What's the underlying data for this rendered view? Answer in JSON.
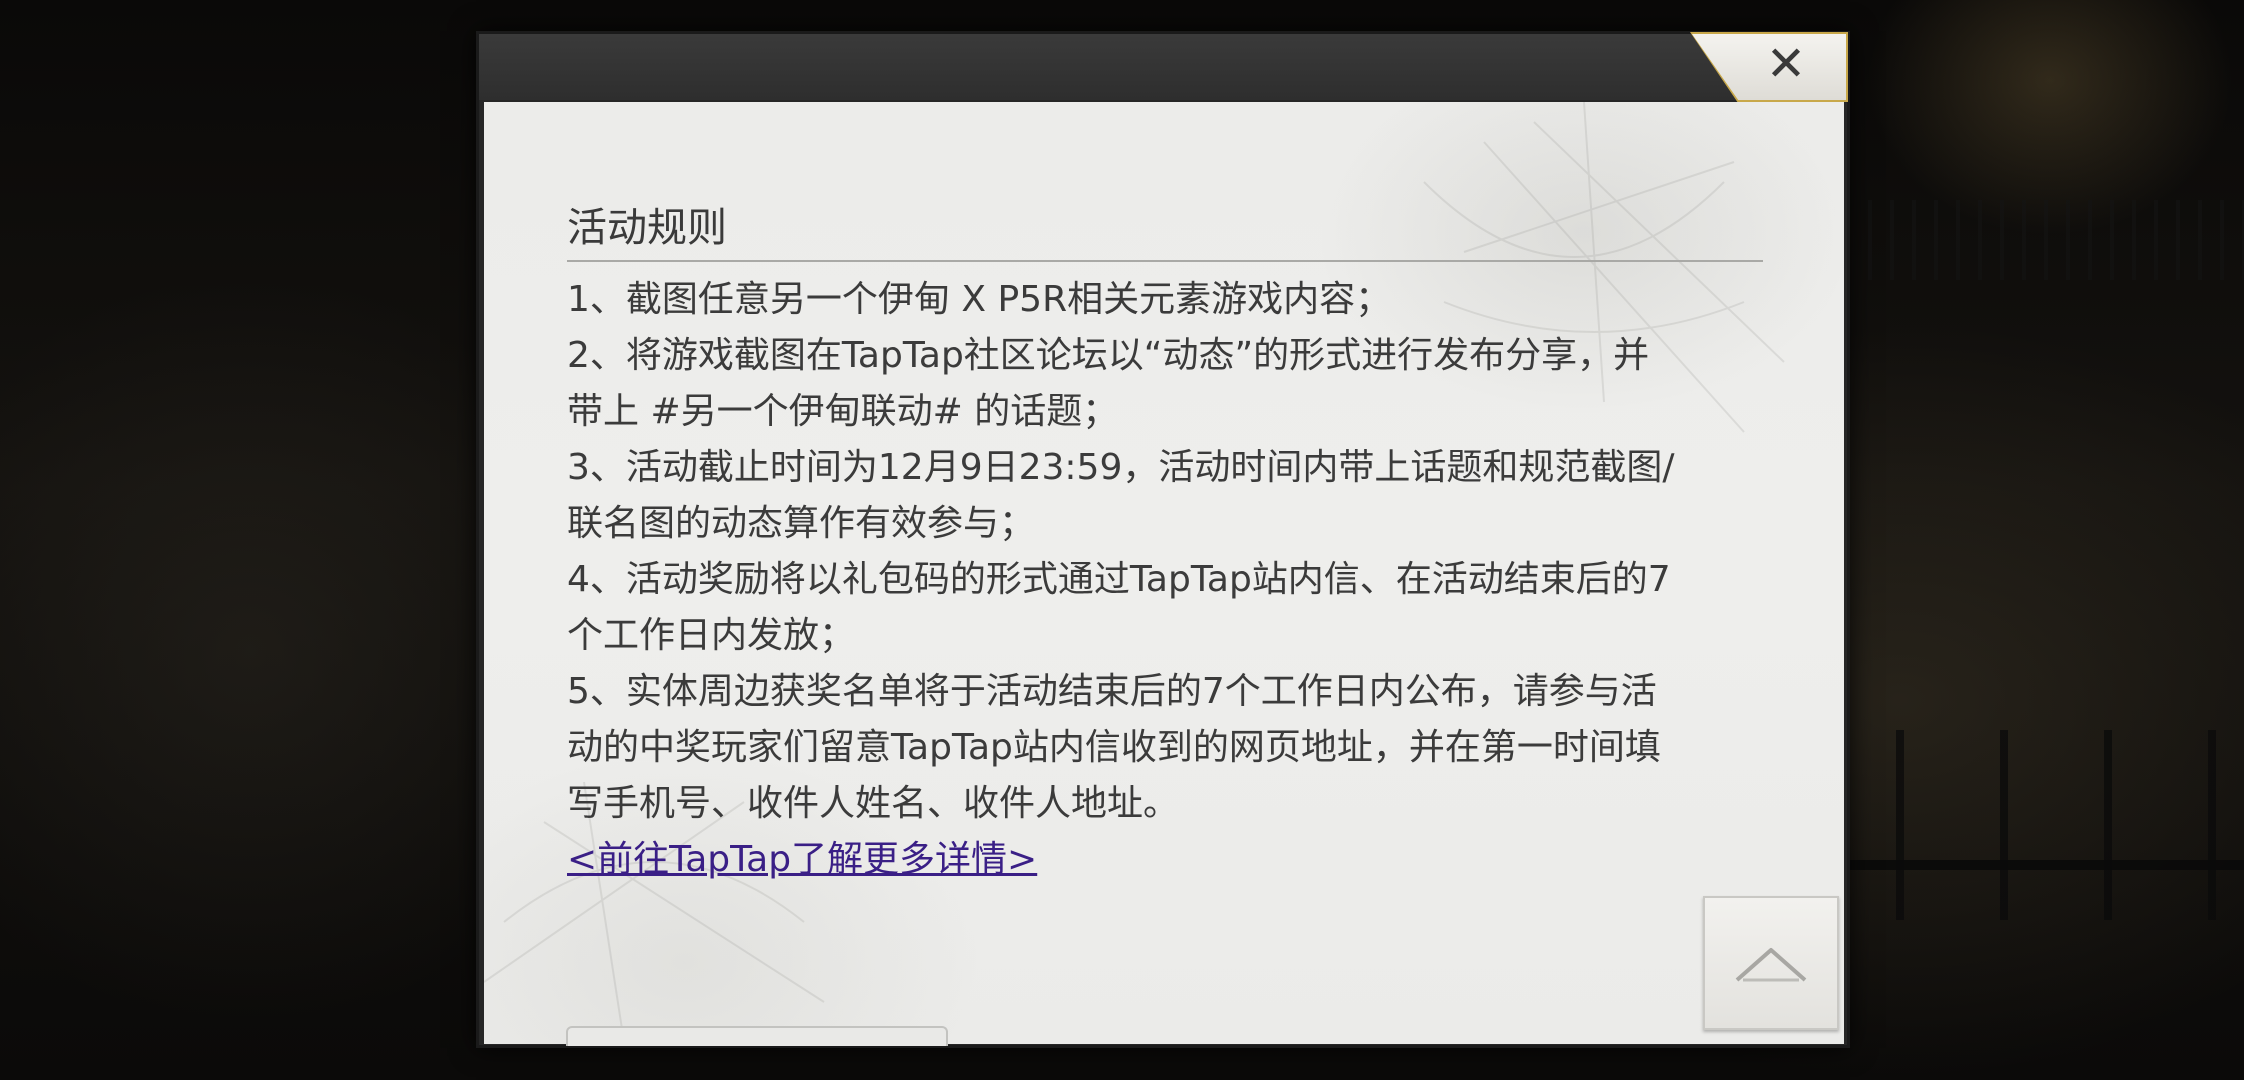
{
  "dialog": {
    "close_icon": "close-icon",
    "scroll_top_icon": "chevron-up-icon"
  },
  "rules": {
    "title": "活动规则",
    "lines": [
      "1、截图任意另一个伊甸 X P5R相关元素游戏内容；",
      "2、将游戏截图在TapTap社区论坛以“动态”的形式进行发布分享，并",
      "带上 #另一个伊甸联动# 的话题；",
      "3、活动截止时间为12月9日23:59，活动时间内带上话题和规范截图/",
      "联名图的动态算作有效参与；",
      "4、活动奖励将以礼包码的形式通过TapTap站内信、在活动结束后的7",
      "个工作日内发放；",
      "5、实体周边获奖名单将于活动结束后的7个工作日内公布，请参与活",
      "动的中奖玩家们留意TapTap站内信收到的网页地址，并在第一时间填",
      "写手机号、收件人姓名、收件人地址。"
    ],
    "link_text": "<前往TapTap了解更多详情>"
  },
  "colors": {
    "link": "#3a1f86",
    "close_border": "#c8a84a",
    "panel_bg": "#ecece9",
    "text": "#3b3b3b"
  }
}
